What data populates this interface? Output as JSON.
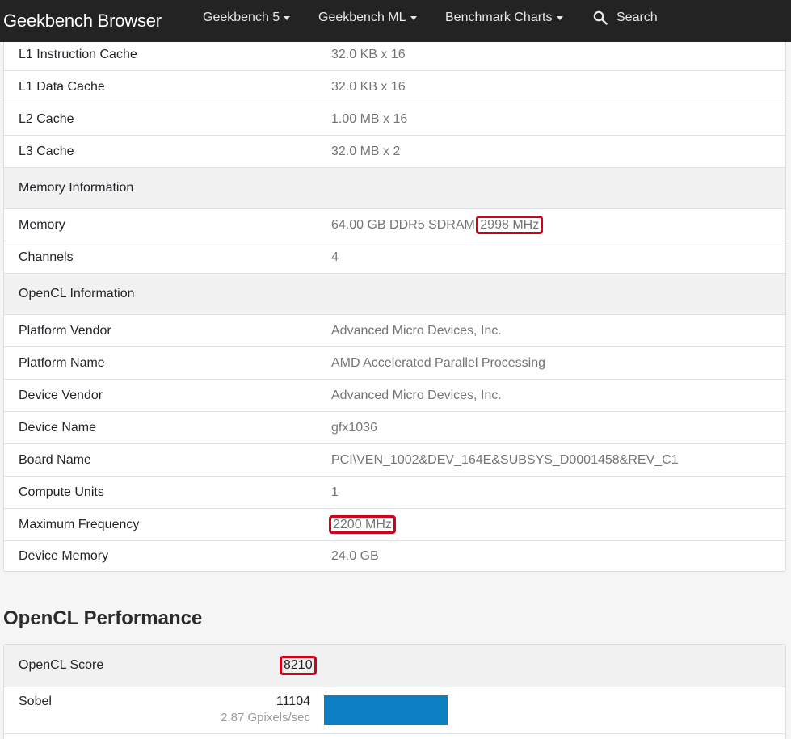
{
  "navbar": {
    "brand": "Geekbench Browser",
    "items": [
      "Geekbench 5",
      "Geekbench ML",
      "Benchmark Charts"
    ],
    "search_label": "Search"
  },
  "info": {
    "rows": [
      {
        "key": "L1 Instruction Cache",
        "value": "32.0 KB x 16"
      },
      {
        "key": "L1 Data Cache",
        "value": "32.0 KB x 16"
      },
      {
        "key": "L2 Cache",
        "value": "1.00 MB x 16"
      },
      {
        "key": "L3 Cache",
        "value": "32.0 MB x 2"
      },
      {
        "section": "Memory Information"
      },
      {
        "key": "Memory",
        "value_prefix": "64.00 GB DDR5 SDRAM ",
        "value_highlight": "2998 MHz"
      },
      {
        "key": "Channels",
        "value": "4"
      },
      {
        "section": "OpenCL Information"
      },
      {
        "key": "Platform Vendor",
        "value": "Advanced Micro Devices, Inc."
      },
      {
        "key": "Platform Name",
        "value": "AMD Accelerated Parallel Processing"
      },
      {
        "key": "Device Vendor",
        "value": "Advanced Micro Devices, Inc."
      },
      {
        "key": "Device Name",
        "value": "gfx1036"
      },
      {
        "key": "Board Name",
        "value": "PCI\\VEN_1002&DEV_164E&SUBSYS_D0001458&REV_C1"
      },
      {
        "key": "Compute Units",
        "value": "1"
      },
      {
        "key": "Maximum Frequency",
        "value_highlight": "2200 MHz"
      },
      {
        "key": "Device Memory",
        "value": "24.0 GB"
      }
    ]
  },
  "performance": {
    "heading": "OpenCL Performance",
    "score_label": "OpenCL Score",
    "score_value": "8210",
    "benchmarks": [
      {
        "name": "Sobel",
        "score": "11104",
        "detail": "2.87 Gpixels/sec",
        "bar_fraction": 0.27
      }
    ]
  },
  "colors": {
    "navbar": "#232323",
    "highlight": "#d0021b",
    "bar": "#0b7fc2"
  }
}
